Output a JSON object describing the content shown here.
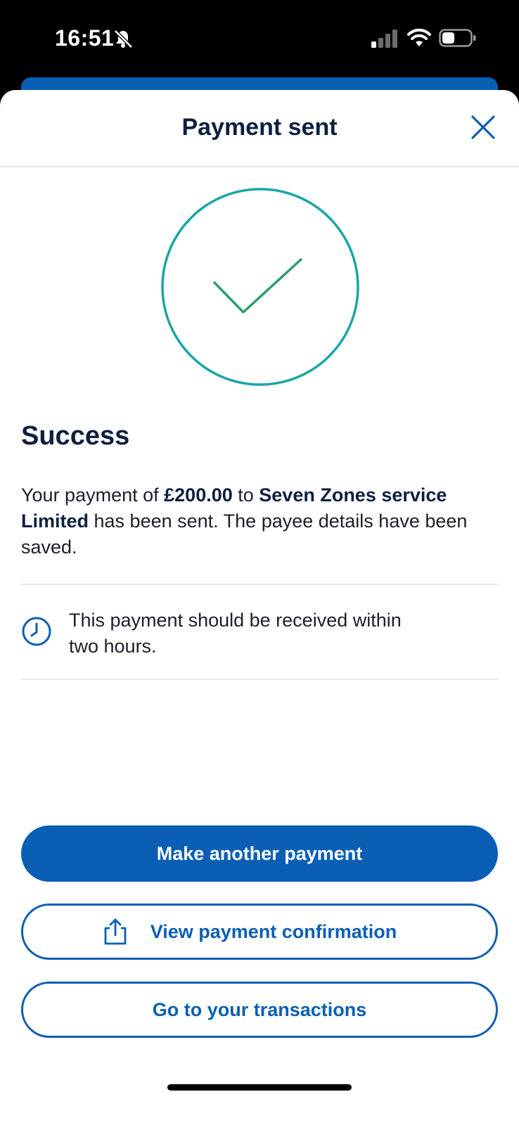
{
  "status_bar": {
    "time": "16:51",
    "icons": [
      "bell-slash-icon",
      "signal-icon",
      "wifi-icon",
      "battery-icon"
    ]
  },
  "header": {
    "title": "Payment sent",
    "close_icon": "close-icon"
  },
  "success": {
    "icon": "check-circle-icon",
    "heading": "Success",
    "message": {
      "part1": "Your payment of ",
      "amount": "£200.00",
      "part2": " to ",
      "payee": "Seven Zones service Limited",
      "part3": " has been sent. The payee details have been saved."
    }
  },
  "info": {
    "icon": "clock-icon",
    "text": "This payment should be received within two hours."
  },
  "buttons": {
    "make_another": "Make another payment",
    "view_confirmation": "View payment confirmation",
    "view_confirmation_icon": "share-icon",
    "go_transactions": "Go to your transactions"
  },
  "colors": {
    "primary": "#0a5fb4",
    "heading": "#0e1f3f",
    "success_ring": "#1aa5a8",
    "success_check": "#2e9e6a"
  }
}
